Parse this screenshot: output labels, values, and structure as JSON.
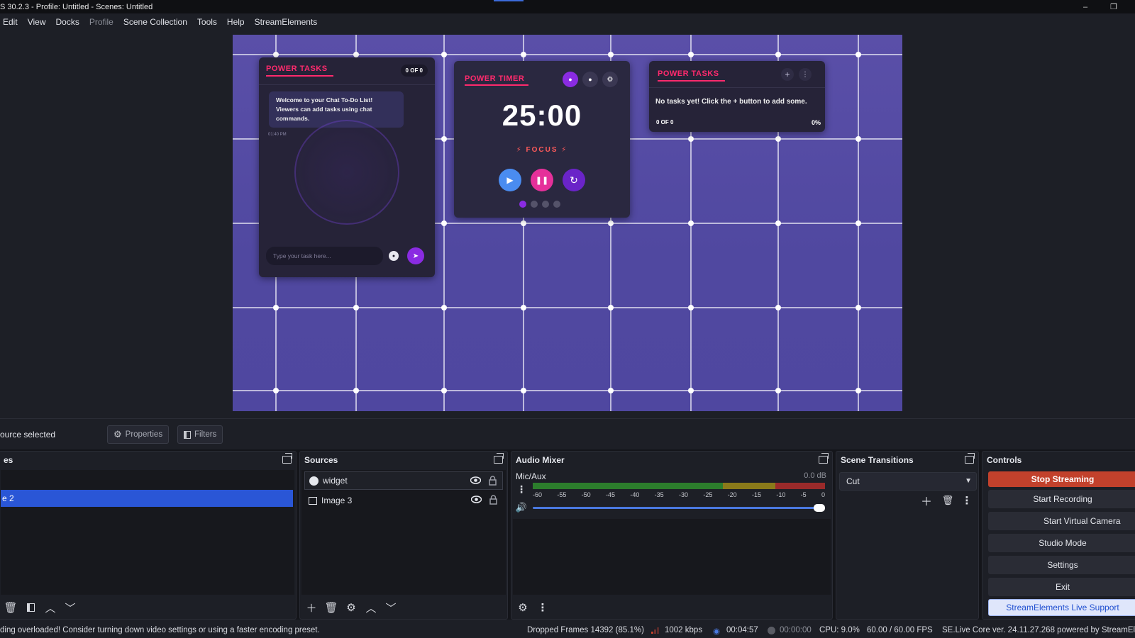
{
  "window": {
    "title": "S 30.2.3 - Profile: Untitled - Scenes: Untitled",
    "minimize": "–",
    "restore": "❐"
  },
  "menu": [
    "Edit",
    "View",
    "Docks",
    "Profile",
    "Scene Collection",
    "Tools",
    "Help",
    "StreamElements"
  ],
  "preview": {
    "tasks_card": {
      "title": "POWER TASKS",
      "count": "0 OF 0",
      "welcome": "Welcome to your Chat To-Do List! Viewers can add tasks using chat commands.",
      "time": "01:40 PM",
      "input_placeholder": "Type your task here..."
    },
    "timer_card": {
      "title": "POWER TIMER",
      "time": "25:00",
      "mode": "⚡ FOCUS ⚡",
      "active_dot": 0,
      "dots": 4
    },
    "tasks_card2": {
      "title": "POWER TASKS",
      "plus": "+",
      "menu": "⋮",
      "message": "No tasks yet! Click the + button to add some.",
      "count": "0 OF 0",
      "percent": "0%"
    }
  },
  "context_bar": {
    "selection": "ource selected",
    "properties": "Properties",
    "filters": "Filters"
  },
  "scenes": {
    "title": "es",
    "selected_item": "e 2"
  },
  "sources": {
    "title": "Sources",
    "items": [
      {
        "name": "widget",
        "icon": "browser-icon"
      },
      {
        "name": "Image 3",
        "icon": "image-icon"
      }
    ]
  },
  "audio_mixer": {
    "title": "Audio Mixer",
    "channel": "Mic/Aux",
    "db": "0.0 dB",
    "ticks": [
      "-60",
      "-55",
      "-50",
      "-45",
      "-40",
      "-35",
      "-30",
      "-25",
      "-20",
      "-15",
      "-10",
      "-5",
      "0"
    ],
    "volume_level": 1.0
  },
  "scene_transitions": {
    "title": "Scene Transitions",
    "selected": "Cut"
  },
  "controls": {
    "title": "Controls",
    "stop_streaming": "Stop Streaming",
    "start_recording": "Start Recording",
    "start_virtual_camera": "Start Virtual Camera",
    "studio_mode": "Studio Mode",
    "settings": "Settings",
    "exit": "Exit",
    "live_support": "StreamElements Live Support"
  },
  "status": {
    "warning": "ding overloaded! Consider turning down video settings or using a faster encoding preset.",
    "dropped": "Dropped Frames 14392 (85.1%)",
    "bitrate": "1002 kbps",
    "stream_time": "00:04:57",
    "record_time": "00:00:00",
    "cpu": "CPU: 9.0%",
    "fps": "60.00 / 60.00 FPS",
    "se_version": "SE.Live Core ver. 24.11.27.268 powered by StreamElements"
  },
  "colors": {
    "accent_blue": "#2a56d6",
    "stop_red": "#c2412c",
    "canvas_purple": "#5a4fa8",
    "title_pink": "#ff2a6d",
    "timer_purple": "#7b2ff7"
  }
}
